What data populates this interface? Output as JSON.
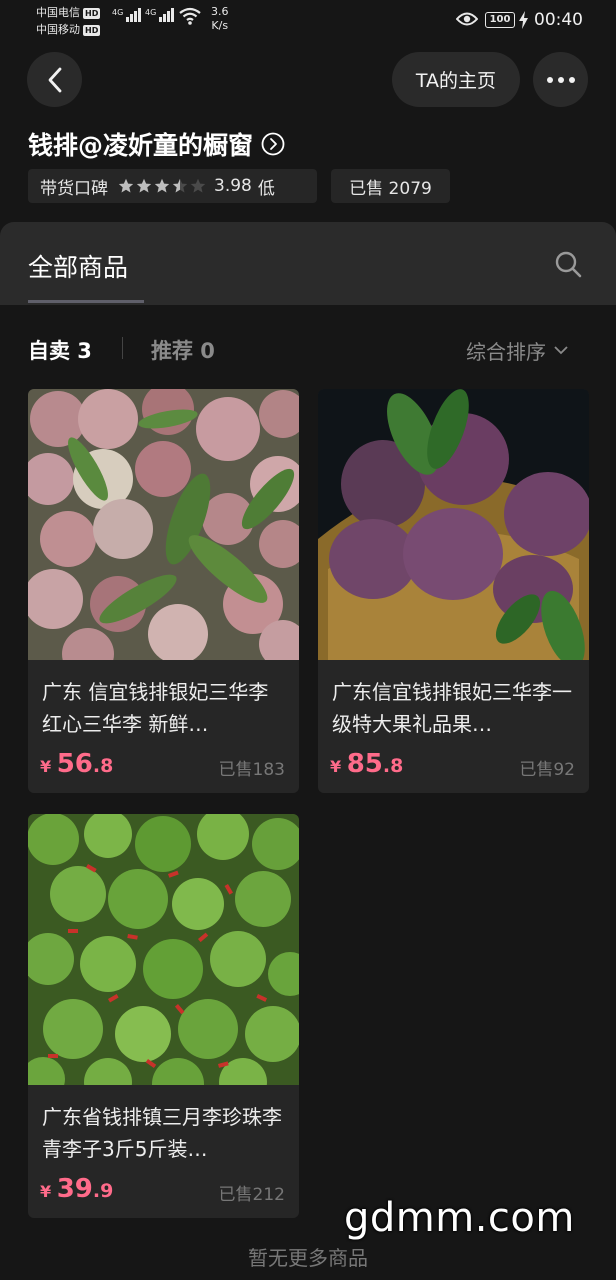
{
  "status_bar": {
    "carrier1": "中国电信",
    "carrier2": "中国移动",
    "hd": "HD",
    "net1": "4G",
    "net2": "4G",
    "speed_value": "3.6",
    "speed_unit": "K/s",
    "battery": "100",
    "time": "00:40"
  },
  "header": {
    "home_label": "TA的主页",
    "shop_title": "钱排@凌妡童的橱窗"
  },
  "rating": {
    "label": "带货口碑",
    "stars_value": 3.5,
    "stars_max": 5,
    "score": "3.98",
    "level": "低"
  },
  "shop_sold": "已售 2079",
  "tabs": {
    "all_products": "全部商品"
  },
  "filters": {
    "self_sold": "自卖 3",
    "recommended": "推荐 0",
    "sort": "综合排序"
  },
  "products": [
    {
      "name": "广东 信宜钱排银妃三华李 红心三华李 新鲜…",
      "currency": "¥",
      "price_int": "56",
      "price_dec": ".8",
      "sold": "已售183"
    },
    {
      "name": "广东信宜钱排银妃三华李一级特大果礼品果…",
      "currency": "¥",
      "price_int": "85",
      "price_dec": ".8",
      "sold": "已售92"
    },
    {
      "name": "广东省钱排镇三月李珍珠李青李子3斤5斤装…",
      "currency": "¥",
      "price_int": "39",
      "price_dec": ".9",
      "sold": "已售212"
    }
  ],
  "footer": {
    "no_more": "暂无更多商品"
  },
  "watermark": "gdmm.com",
  "colors": {
    "background": "#161616",
    "price": "#ff6b8a",
    "chip": "#262626"
  }
}
